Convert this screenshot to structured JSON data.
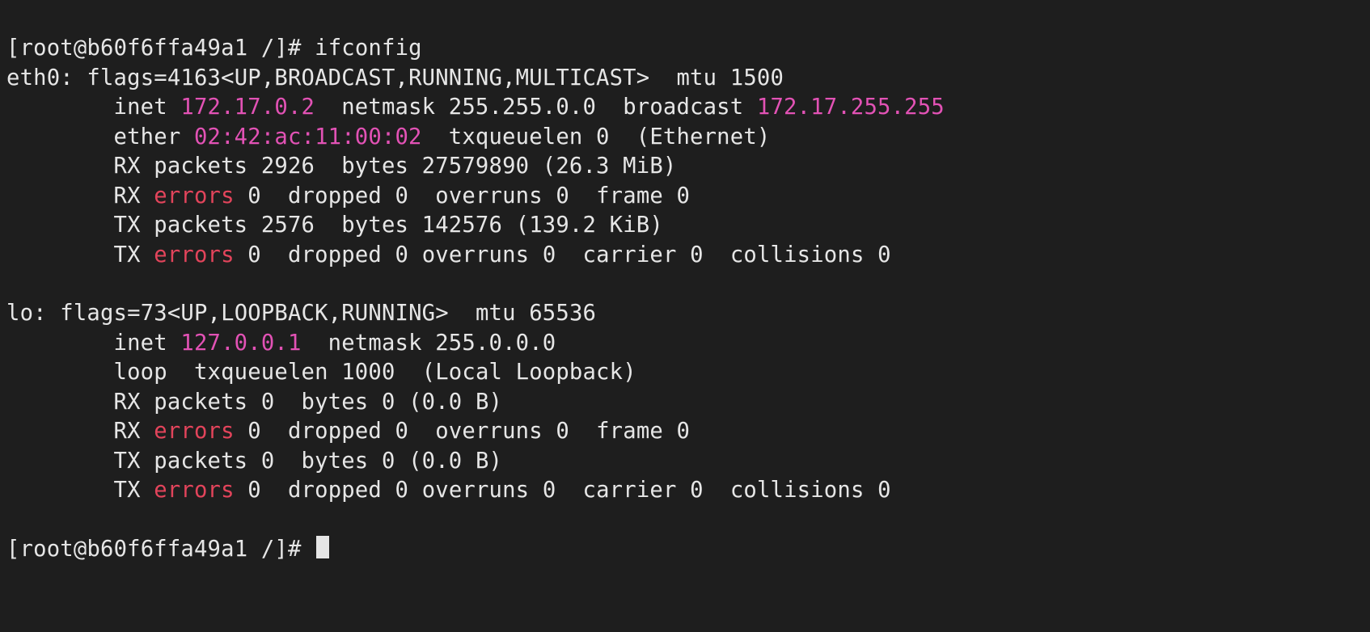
{
  "prompt": {
    "user": "root",
    "host": "b60f6ffa49a1",
    "cwd": "/",
    "symbol": "#"
  },
  "command": "ifconfig",
  "interfaces": [
    {
      "name": "eth0",
      "flags_num": "4163",
      "flags_list": "UP,BROADCAST,RUNNING,MULTICAST",
      "mtu": "1500",
      "inet": "172.17.0.2",
      "netmask": "255.255.0.0",
      "broadcast": "172.17.255.255",
      "mac": "02:42:ac:11:00:02",
      "link_kind": "ether",
      "txqueuelen": "0",
      "type_label": "Ethernet",
      "rx_packets": "2926",
      "rx_bytes": "27579890",
      "rx_bytes_human": "26.3 MiB",
      "rx_errors": "0",
      "rx_dropped": "0",
      "rx_overruns": "0",
      "rx_frame": "0",
      "tx_packets": "2576",
      "tx_bytes": "142576",
      "tx_bytes_human": "139.2 KiB",
      "tx_errors": "0",
      "tx_dropped": "0",
      "tx_overruns": "0",
      "tx_carrier": "0",
      "tx_collisions": "0"
    },
    {
      "name": "lo",
      "flags_num": "73",
      "flags_list": "UP,LOOPBACK,RUNNING",
      "mtu": "65536",
      "inet": "127.0.0.1",
      "netmask": "255.0.0.0",
      "broadcast": null,
      "mac": null,
      "link_kind": "loop",
      "txqueuelen": "1000",
      "type_label": "Local Loopback",
      "rx_packets": "0",
      "rx_bytes": "0",
      "rx_bytes_human": "0.0 B",
      "rx_errors": "0",
      "rx_dropped": "0",
      "rx_overruns": "0",
      "rx_frame": "0",
      "tx_packets": "0",
      "tx_bytes": "0",
      "tx_bytes_human": "0.0 B",
      "tx_errors": "0",
      "tx_dropped": "0",
      "tx_overruns": "0",
      "tx_carrier": "0",
      "tx_collisions": "0"
    }
  ],
  "labels": {
    "flags": "flags",
    "mtu": "mtu",
    "inet": "inet",
    "netmask": "netmask",
    "broadcast": "broadcast",
    "ether": "ether",
    "loop": "loop",
    "txqueuelen": "txqueuelen",
    "rx_packets": "RX packets",
    "bytes": "bytes",
    "rx_errors_prefix": "RX",
    "tx_errors_prefix": "TX",
    "errors": "errors",
    "dropped": "dropped",
    "overruns": "overruns",
    "frame": "frame",
    "tx_packets": "TX packets",
    "carrier": "carrier",
    "collisions": "collisions"
  }
}
